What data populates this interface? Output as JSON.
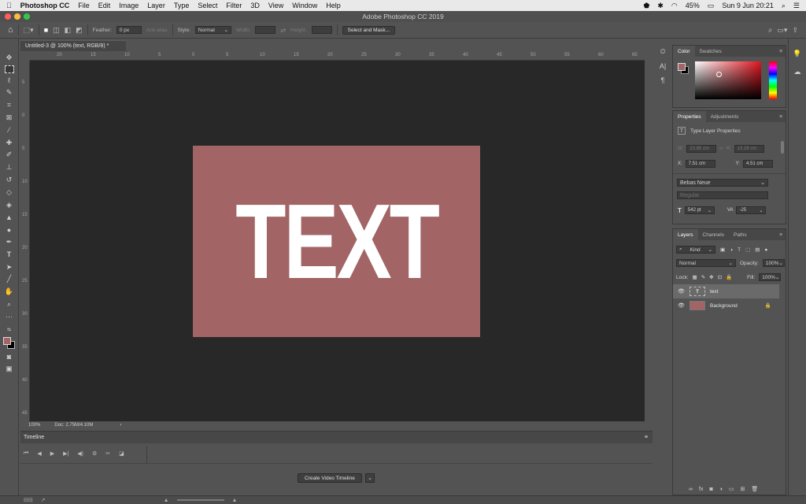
{
  "menubar": {
    "apple": "",
    "app": "Photoshop CC",
    "items": [
      "File",
      "Edit",
      "Image",
      "Layer",
      "Type",
      "Select",
      "Filter",
      "3D",
      "View",
      "Window",
      "Help"
    ],
    "battery": "45%",
    "datetime": "Sun 9 Jun  20:21"
  },
  "window": {
    "title": "Adobe Photoshop CC 2019"
  },
  "options": {
    "feather_label": "Feather:",
    "feather_value": "0 px",
    "antialias_label": "Anti-alias",
    "style_label": "Style:",
    "style_value": "Normal",
    "width_label": "Width:",
    "height_label": "Height:",
    "select_mask": "Select and Mask..."
  },
  "document": {
    "tab_title": "Untitled-3 @ 100% (text, RGB/8) *",
    "canvas_text": "TEXT",
    "bg_color": "#a26464",
    "zoom": "100%",
    "doc_info": "Doc: 2.75M/4.10M"
  },
  "ruler_h": [
    "20",
    "15",
    "10",
    "5",
    "0",
    "5",
    "10",
    "15",
    "20",
    "25",
    "30",
    "35",
    "40",
    "45",
    "50",
    "55",
    "60",
    "65"
  ],
  "ruler_v": [
    "5",
    "0",
    "5",
    "10",
    "15",
    "20",
    "25",
    "30",
    "35",
    "40",
    "45"
  ],
  "timeline": {
    "title": "Timeline",
    "create_button": "Create Video Timeline"
  },
  "color_panel": {
    "tabs": [
      "Color",
      "Swatches"
    ],
    "fg": "#a26464"
  },
  "properties": {
    "tabs": [
      "Properties",
      "Adjustments"
    ],
    "heading": "Type Layer Properties",
    "w_label": "W:",
    "w_value": "23.85 cm",
    "h_label": "H:",
    "h_value": "13.28 cm",
    "x_label": "X:",
    "x_value": "7.51 cm",
    "y_label": "Y:",
    "y_value": "4.51 cm",
    "font": "Bebas Neue",
    "style": "Regular",
    "size": "542 pt",
    "tracking": "-25"
  },
  "layers": {
    "tabs": [
      "Layers",
      "Channels",
      "Paths"
    ],
    "kind": "Kind",
    "blend": "Normal",
    "opacity_label": "Opacity:",
    "opacity_value": "100%",
    "lock_label": "Lock:",
    "fill_label": "Fill:",
    "fill_value": "100%",
    "items": [
      {
        "name": "text",
        "type": "T"
      },
      {
        "name": "Background",
        "type": "bg"
      }
    ]
  }
}
